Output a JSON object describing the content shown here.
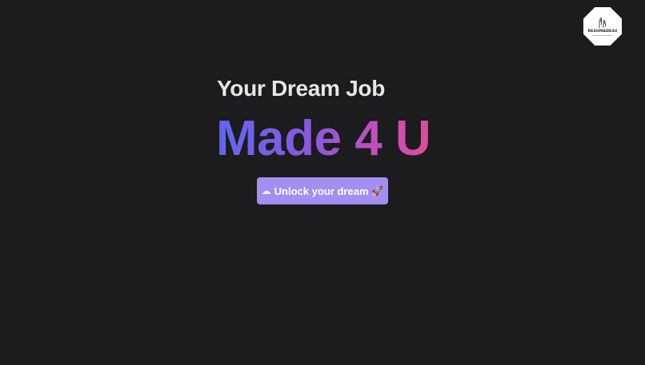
{
  "logo": {
    "text": "RESUMADE4U",
    "icon": "hands-icon"
  },
  "hero": {
    "subtitle": "Your Dream Job",
    "title": "Made 4 U",
    "gradient": [
      "#5f67f0",
      "#8b57de",
      "#c64fb8",
      "#dc4d95"
    ]
  },
  "cta": {
    "icon_left": "cloud-icon",
    "icon_left_glyph": "☁",
    "label": "Unlock your dream",
    "icon_right": "rocket-icon",
    "icon_right_glyph": "🚀",
    "color": "#a38ef1"
  },
  "colors": {
    "background": "#1c1b1d",
    "text": "#e6e6e8"
  }
}
